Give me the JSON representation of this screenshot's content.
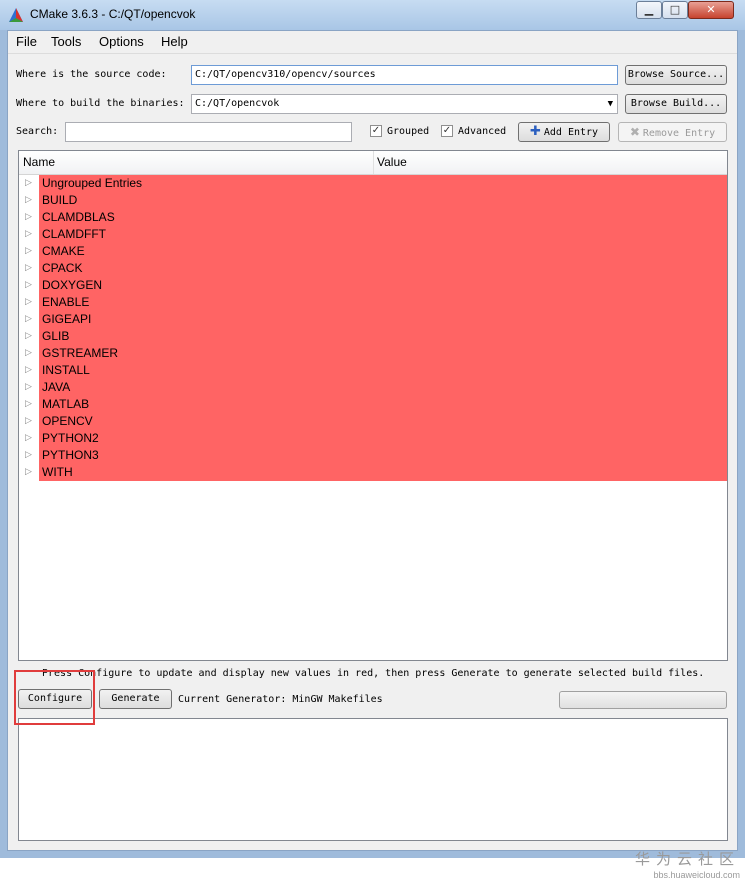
{
  "window": {
    "title": "CMake 3.6.3 - C:/QT/opencvok",
    "controls": {
      "minimize": "▁",
      "maximize": "□",
      "close": "✕"
    }
  },
  "menu": [
    "File",
    "Tools",
    "Options",
    "Help"
  ],
  "source": {
    "label": "Where is the source code:",
    "value": "C:/QT/opencv310/opencv/sources",
    "browse_label": "Browse Source..."
  },
  "build": {
    "label": "Where to build the binaries:",
    "value": "C:/QT/opencvok",
    "browse_label": "Browse Build..."
  },
  "search": {
    "label": "Search:",
    "value": "",
    "grouped_label": "Grouped",
    "grouped_checked": "✓",
    "advanced_label": "Advanced",
    "advanced_checked": "✓",
    "add_entry_label": "Add Entry",
    "remove_entry_label": "Remove Entry"
  },
  "tree": {
    "columns": [
      "Name",
      "Value"
    ],
    "highlight_color": "#ff6464",
    "entries": [
      "Ungrouped Entries",
      "BUILD",
      "CLAMDBLAS",
      "CLAMDFFT",
      "CMAKE",
      "CPACK",
      "DOXYGEN",
      "ENABLE",
      "GIGEAPI",
      "GLIB",
      "GSTREAMER",
      "INSTALL",
      "JAVA",
      "MATLAB",
      "OPENCV",
      "PYTHON2",
      "PYTHON3",
      "WITH"
    ]
  },
  "hint": "Press Configure to update and display new values in red, then press Generate to generate selected build files.",
  "actions": {
    "configure_label": "Configure",
    "generate_label": "Generate",
    "generator_text": "Current Generator: MinGW Makefiles"
  },
  "watermark": {
    "cn": "华为云社区",
    "url": "bbs.huaweicloud.com"
  }
}
